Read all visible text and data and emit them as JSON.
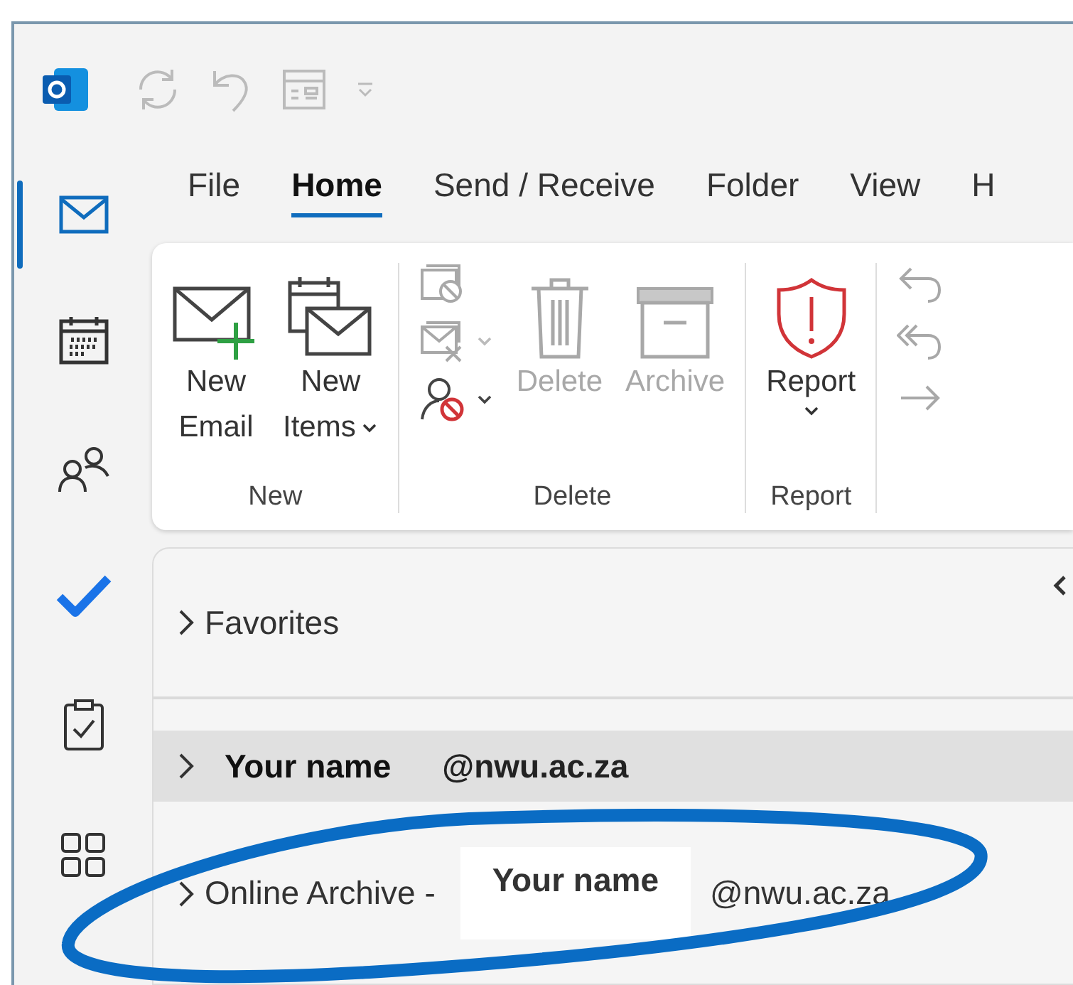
{
  "tabs": [
    {
      "label": "File",
      "selected": false
    },
    {
      "label": "Home",
      "selected": true
    },
    {
      "label": "Send / Receive",
      "selected": false
    },
    {
      "label": "Folder",
      "selected": false
    },
    {
      "label": "View",
      "selected": false
    },
    {
      "label": "H",
      "selected": false
    }
  ],
  "ribbon": {
    "groups": [
      {
        "label": "New",
        "large_buttons": [
          {
            "kind": "new-email",
            "lines": [
              "New",
              "Email"
            ],
            "dropdown": false,
            "disabled": false
          },
          {
            "kind": "new-items",
            "lines": [
              "New",
              "Items"
            ],
            "dropdown": true,
            "disabled": false
          }
        ]
      },
      {
        "label": "Delete",
        "small_buttons": [
          {
            "kind": "ignore",
            "dropdown": false,
            "disabled": true
          },
          {
            "kind": "clean-up",
            "dropdown": true,
            "disabled": true
          },
          {
            "kind": "block",
            "dropdown": true,
            "disabled": false
          }
        ],
        "large_buttons": [
          {
            "kind": "delete",
            "lines": [
              "Delete"
            ],
            "dropdown": false,
            "disabled": true
          },
          {
            "kind": "archive",
            "lines": [
              "Archive"
            ],
            "dropdown": false,
            "disabled": true
          }
        ]
      },
      {
        "label": "Report",
        "large_buttons": [
          {
            "kind": "report",
            "lines": [
              "Report"
            ],
            "dropdown": true,
            "disabled": false
          }
        ]
      },
      {
        "small_buttons": [
          {
            "kind": "reply",
            "dropdown": false,
            "disabled": true
          },
          {
            "kind": "reply-all",
            "dropdown": false,
            "disabled": true
          },
          {
            "kind": "forward",
            "dropdown": false,
            "disabled": true
          }
        ]
      }
    ]
  },
  "folder_pane": {
    "favorites": {
      "label": "Favorites",
      "expanded": false
    },
    "accounts": [
      {
        "kind": "mailbox",
        "name": "Your name",
        "address": "@nwu.ac.za",
        "selected": true,
        "expanded": false
      },
      {
        "kind": "archive",
        "prefix": "Online Archive -",
        "name": "Your name",
        "address": "@nwu.ac.za",
        "selected": false,
        "expanded": false
      }
    ]
  }
}
